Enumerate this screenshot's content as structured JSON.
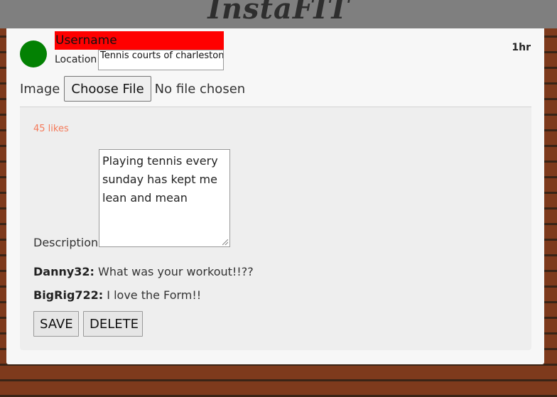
{
  "header": {
    "logo_text": "InstaFIT"
  },
  "post": {
    "username": "Username",
    "location_label": "Location",
    "location_value": "Tennis courts of charleston",
    "time": "1hr",
    "image_label": "Image",
    "file_button": "Choose File",
    "file_status": "No file chosen",
    "likes": "45 likes",
    "description_label": "Description",
    "description": "Playing tennis every sunday has kept me lean and mean",
    "comments": [
      {
        "user": "Danny32:",
        "text": " What was your workout!!??"
      },
      {
        "user": "BigRig722:",
        "text": " I love the Form!!"
      }
    ],
    "save_label": "SAVE",
    "delete_label": "DELETE"
  },
  "colors": {
    "avatar": "#038103",
    "username_bg": "#ff0000",
    "likes_text": "#f47a5a",
    "header_bg": "#7f7f7f"
  }
}
